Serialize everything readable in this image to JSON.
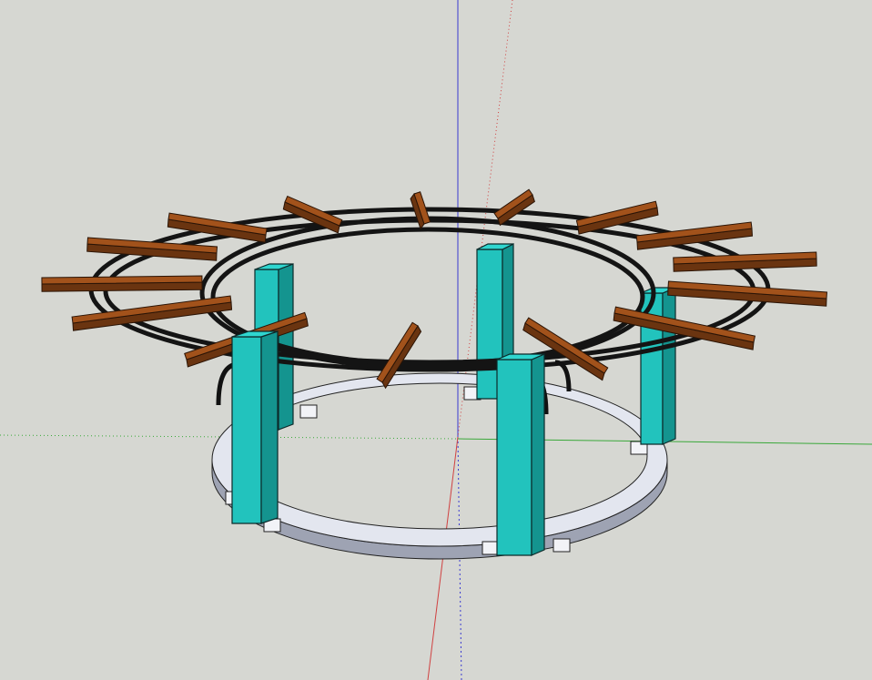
{
  "viewport": {
    "background_color": "#d6d7d2",
    "axes": {
      "red": "#d04040",
      "green": "#3aa83a",
      "blue": "#3a3ad0"
    }
  },
  "model": {
    "description_icon": "round-pergola-model",
    "colors": {
      "post_face": "#22c3bd",
      "post_side": "#14948f",
      "post_outline": "#0c2a2a",
      "bench_top": "#e3e6ef",
      "bench_side": "#9ea3b3",
      "ring_beam": "#141414",
      "rafter_top": "#a2521b",
      "rafter_side": "#6a3410",
      "bracket": "#111111"
    }
  }
}
